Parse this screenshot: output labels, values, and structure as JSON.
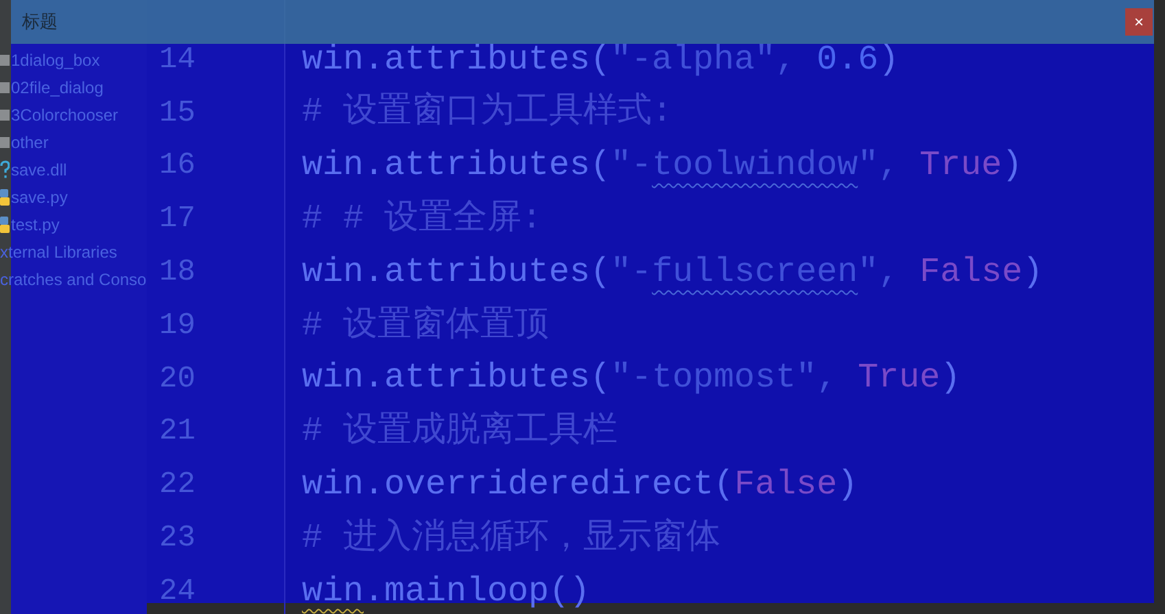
{
  "project_tree": {
    "items": [
      {
        "label": "1dialog_box",
        "kind": "folder"
      },
      {
        "label": "02file_dialog",
        "kind": "folder"
      },
      {
        "label": "3Colorchooser",
        "kind": "folder"
      },
      {
        "label": "other",
        "kind": "folder"
      },
      {
        "label": "save.dll",
        "kind": "unknown"
      },
      {
        "label": "save.py",
        "kind": "python"
      },
      {
        "label": "test.py",
        "kind": "python"
      },
      {
        "label": "xternal Libraries",
        "kind": "plain"
      },
      {
        "label": "cratches and Conso",
        "kind": "plain"
      }
    ]
  },
  "editor": {
    "lines": [
      {
        "number": "14",
        "tokens": [
          {
            "text": "win.attributes(",
            "kind": "code",
            "warning": false
          },
          {
            "text": "\"-alpha\", ",
            "kind": "string",
            "warning": false
          },
          {
            "text": "0.6",
            "kind": "number",
            "warning": false
          },
          {
            "text": ")",
            "kind": "code",
            "warning": false
          }
        ]
      },
      {
        "number": "15",
        "tokens": [
          {
            "text": "# 设置窗口为工具样式:",
            "kind": "comment",
            "warning": false
          }
        ]
      },
      {
        "number": "16",
        "tokens": [
          {
            "text": "win.attributes(",
            "kind": "code",
            "warning": false
          },
          {
            "text": "\"-",
            "kind": "string",
            "warning": false
          },
          {
            "text": "toolwindow",
            "kind": "string",
            "warning": true
          },
          {
            "text": "\", ",
            "kind": "string",
            "warning": false
          },
          {
            "text": "True",
            "kind": "keyword",
            "warning": false
          },
          {
            "text": ")",
            "kind": "code",
            "warning": false
          }
        ]
      },
      {
        "number": "17",
        "tokens": [
          {
            "text": "# # 设置全屏:",
            "kind": "comment",
            "warning": false
          }
        ]
      },
      {
        "number": "18",
        "tokens": [
          {
            "text": "win.attributes(",
            "kind": "code",
            "warning": false
          },
          {
            "text": "\"-",
            "kind": "string",
            "warning": false
          },
          {
            "text": "fullscreen",
            "kind": "string",
            "warning": true
          },
          {
            "text": "\", ",
            "kind": "string",
            "warning": false
          },
          {
            "text": "False",
            "kind": "keyword",
            "warning": false
          },
          {
            "text": ")",
            "kind": "code",
            "warning": false
          }
        ]
      },
      {
        "number": "19",
        "tokens": [
          {
            "text": "# 设置窗体置顶",
            "kind": "comment",
            "warning": false
          }
        ]
      },
      {
        "number": "20",
        "tokens": [
          {
            "text": "win.attributes(",
            "kind": "code",
            "warning": false
          },
          {
            "text": "\"-topmost\", ",
            "kind": "string",
            "warning": false
          },
          {
            "text": "True",
            "kind": "keyword",
            "warning": false
          },
          {
            "text": ")",
            "kind": "code",
            "warning": false
          }
        ]
      },
      {
        "number": "21",
        "tokens": [
          {
            "text": "# 设置成脱离工具栏",
            "kind": "comment",
            "warning": false
          }
        ]
      },
      {
        "number": "22",
        "tokens": [
          {
            "text": "win.overrideredirect(",
            "kind": "code",
            "warning": false
          },
          {
            "text": "False",
            "kind": "keyword",
            "warning": false
          },
          {
            "text": ")",
            "kind": "code",
            "warning": false
          }
        ]
      },
      {
        "number": "23",
        "tokens": [
          {
            "text": "# 进入消息循环，显示窗体",
            "kind": "comment",
            "warning": false
          }
        ]
      },
      {
        "number": "24",
        "tokens": [
          {
            "text": "win",
            "kind": "code",
            "warning": true
          },
          {
            "text": ".mainloop()",
            "kind": "code",
            "warning": false
          }
        ]
      }
    ]
  },
  "overlay_window": {
    "title": "标题",
    "close_label": "×"
  }
}
